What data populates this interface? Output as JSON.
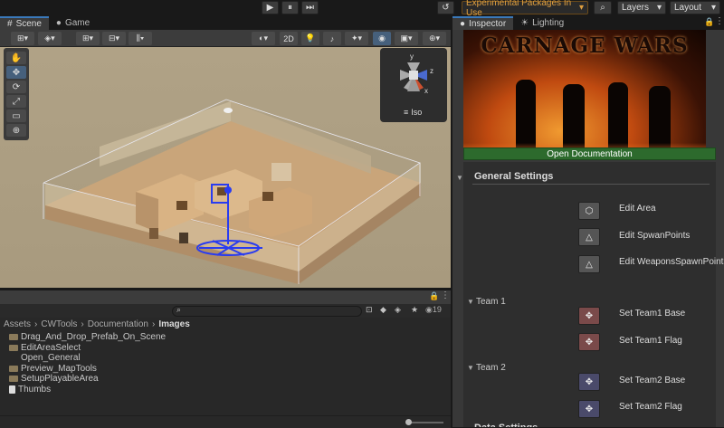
{
  "topbar": {
    "play": "▶",
    "pause": "⏸",
    "step": "⏭",
    "history_icon": "↺",
    "experimental_label": "Experimental Packages In Use",
    "experimental_caret": "▾",
    "search_icon": "⌕",
    "layers_label": "Layers",
    "layout_label": "Layout",
    "caret": "▾"
  },
  "scene": {
    "tabs": [
      {
        "label": "Scene",
        "icon": "#"
      },
      {
        "label": "Game",
        "icon": "●"
      }
    ],
    "toolbar": {
      "btn_2d": "2D"
    },
    "tools": [
      "✋",
      "✥",
      "⟳",
      "⤢",
      "▭",
      "⊕"
    ],
    "gizmo": {
      "label": "Iso",
      "axis_y": "y",
      "axis_z": "z",
      "axis_x": "x"
    }
  },
  "project": {
    "breadcrumb": [
      "Assets",
      "CWTools",
      "Documentation",
      "Images"
    ],
    "files": [
      {
        "name": "Drag_And_Drop_Prefab_On_Scene",
        "icon": "img"
      },
      {
        "name": "EditAreaSelect",
        "icon": "img"
      },
      {
        "name": "Open_General",
        "icon": "none"
      },
      {
        "name": "Preview_MapTools",
        "icon": "img"
      },
      {
        "name": "SetupPlayableArea",
        "icon": "img"
      },
      {
        "name": "Thumbs",
        "icon": "doc"
      }
    ],
    "count": "19"
  },
  "inspector": {
    "tabs": [
      {
        "label": "Inspector",
        "icon": "●"
      },
      {
        "label": "Lighting",
        "icon": "☀"
      }
    ],
    "banner_title": "CARNAGE WARS",
    "open_doc_label": "Open Documentation",
    "general_settings": "General Settings",
    "general_actions": [
      {
        "label": "Edit Area",
        "icon": "⬡"
      },
      {
        "label": "Edit SpwanPoints",
        "icon": "△"
      },
      {
        "label": "Edit WeaponsSpawnPoints",
        "icon": "△"
      }
    ],
    "team1_label": "Team 1",
    "team1_actions": [
      {
        "label": "Set Team1 Base",
        "icon": "✥"
      },
      {
        "label": "Set Team1 Flag",
        "icon": "✥"
      }
    ],
    "team2_label": "Team 2",
    "team2_actions": [
      {
        "label": "Set Team2 Base",
        "icon": "✥"
      },
      {
        "label": "Set Team2 Flag",
        "icon": "✥"
      }
    ],
    "next_section": "Data Settings"
  },
  "colors": {
    "team1_button": "#7a4a4a",
    "team2_button": "#4a4a6a",
    "general_button": "#555555",
    "open_doc": "#2d6a2d",
    "accent": "#3a79bb",
    "experimental": "#e0a040"
  }
}
